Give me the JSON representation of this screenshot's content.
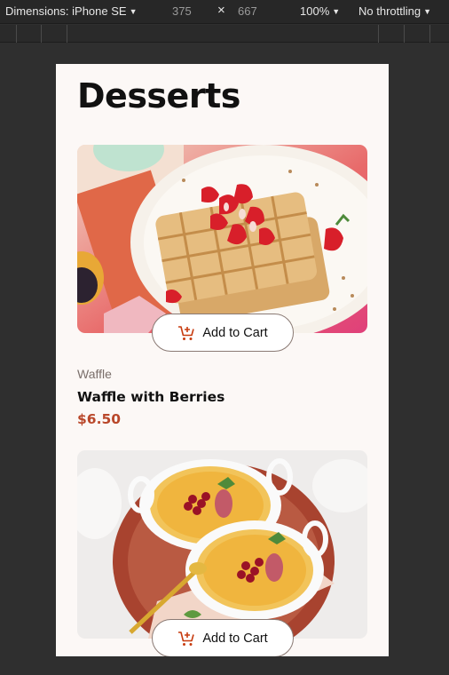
{
  "devtools": {
    "device": "Dimensions: iPhone SE",
    "width": "375",
    "times": "×",
    "height": "667",
    "zoom": "100%",
    "throttling": "No throttling"
  },
  "page": {
    "title": "Desserts"
  },
  "products": [
    {
      "category": "Waffle",
      "name": "Waffle with Berries",
      "price": "$6.50",
      "button": "Add to Cart"
    },
    {
      "button": "Add to Cart"
    }
  ],
  "colors": {
    "accent": "#c73b0f",
    "price": "#b9472a",
    "background": "#fcf8f6"
  }
}
